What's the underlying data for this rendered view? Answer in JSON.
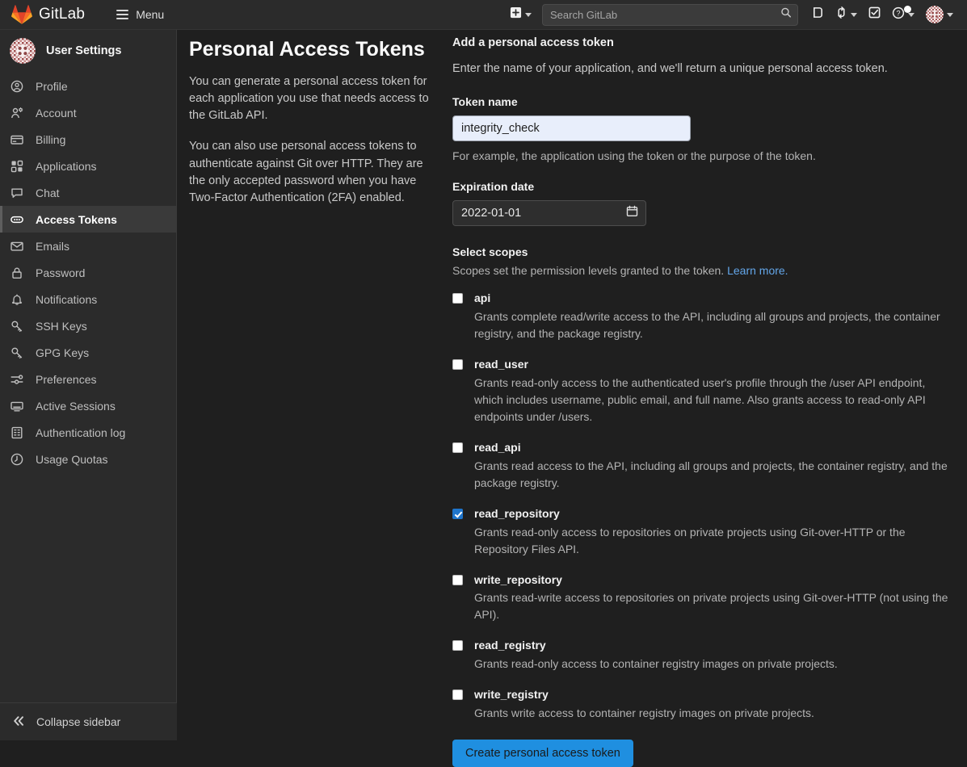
{
  "navbar": {
    "brand": "GitLab",
    "brand_logo_icon": "gitlab-tanuki-logo",
    "menu_label": "Menu",
    "menu_icon": "hamburger-icon",
    "create_new_icon": "plus-square-icon",
    "search": {
      "placeholder": "Search GitLab",
      "value": "",
      "icon": "search-icon"
    },
    "issues_icon": "issues-icon",
    "merge_requests_icon": "merge-request-icon",
    "todos_icon": "todo-checkbox-icon",
    "help_icon": "question-circle-icon",
    "user_avatar_icon": "user-avatar-identicon"
  },
  "sidebar": {
    "title": "User Settings",
    "avatar_icon": "user-avatar-identicon",
    "items": [
      {
        "label": "Profile",
        "icon": "user-circle-icon",
        "active": false
      },
      {
        "label": "Account",
        "icon": "account-gear-icon",
        "active": false
      },
      {
        "label": "Billing",
        "icon": "credit-card-icon",
        "active": false
      },
      {
        "label": "Applications",
        "icon": "grid-squares-icon",
        "active": false
      },
      {
        "label": "Chat",
        "icon": "speech-bubble-icon",
        "active": false
      },
      {
        "label": "Access Tokens",
        "icon": "token-pill-icon",
        "active": true
      },
      {
        "label": "Emails",
        "icon": "envelope-icon",
        "active": false
      },
      {
        "label": "Password",
        "icon": "lock-icon",
        "active": false
      },
      {
        "label": "Notifications",
        "icon": "bell-icon",
        "active": false
      },
      {
        "label": "SSH Keys",
        "icon": "key-icon",
        "active": false
      },
      {
        "label": "GPG Keys",
        "icon": "key-icon",
        "active": false
      },
      {
        "label": "Preferences",
        "icon": "sliders-icon",
        "active": false
      },
      {
        "label": "Active Sessions",
        "icon": "monitor-icon",
        "active": false
      },
      {
        "label": "Authentication log",
        "icon": "log-list-icon",
        "active": false
      },
      {
        "label": "Usage Quotas",
        "icon": "clock-quota-icon",
        "active": false
      }
    ],
    "collapse_label": "Collapse sidebar",
    "collapse_icon": "double-chevron-left-icon"
  },
  "main": {
    "page_title": "Personal Access Tokens",
    "intro_paragraph_1": "You can generate a personal access token for each application you use that needs access to the GitLab API.",
    "intro_paragraph_2": "You can also use personal access tokens to authenticate against Git over HTTP. They are the only accepted password when you have Two-Factor Authentication (2FA) enabled.",
    "form": {
      "heading": "Add a personal access token",
      "subheading": "Enter the name of your application, and we'll return a unique personal access token.",
      "token_name_label": "Token name",
      "token_name_value": "integrity_check",
      "token_name_placeholder": "",
      "token_name_help": "For example, the application using the token or the purpose of the token.",
      "expiration_label": "Expiration date",
      "expiration_value": "2022-01-01",
      "expiration_icon": "calendar-icon",
      "scopes_title": "Select scopes",
      "scopes_desc_text": "Scopes set the permission levels granted to the token.",
      "scopes_link_text": "Learn more.",
      "submit_label": "Create personal access token"
    },
    "scopes": [
      {
        "name": "api",
        "checked": false,
        "description": "Grants complete read/write access to the API, including all groups and projects, the container registry, and the package registry."
      },
      {
        "name": "read_user",
        "checked": false,
        "description": "Grants read-only access to the authenticated user's profile through the /user API endpoint, which includes username, public email, and full name. Also grants access to read-only API endpoints under /users."
      },
      {
        "name": "read_api",
        "checked": false,
        "description": "Grants read access to the API, including all groups and projects, the container registry, and the package registry."
      },
      {
        "name": "read_repository",
        "checked": true,
        "description": "Grants read-only access to repositories on private projects using Git-over-HTTP or the Repository Files API."
      },
      {
        "name": "write_repository",
        "checked": false,
        "description": "Grants read-write access to repositories on private projects using Git-over-HTTP (not using the API)."
      },
      {
        "name": "read_registry",
        "checked": false,
        "description": "Grants read-only access to container registry images on private projects."
      },
      {
        "name": "write_registry",
        "checked": false,
        "description": "Grants write access to container registry images on private projects."
      }
    ]
  },
  "colors": {
    "accent_blue": "#1f8fe0",
    "link_blue": "#63a6e9",
    "checkbox_checked": "#1f75cb",
    "sidebar_bg": "#2b2b2b",
    "content_bg": "#1f1f1f",
    "logo_orange": "#e24329"
  }
}
